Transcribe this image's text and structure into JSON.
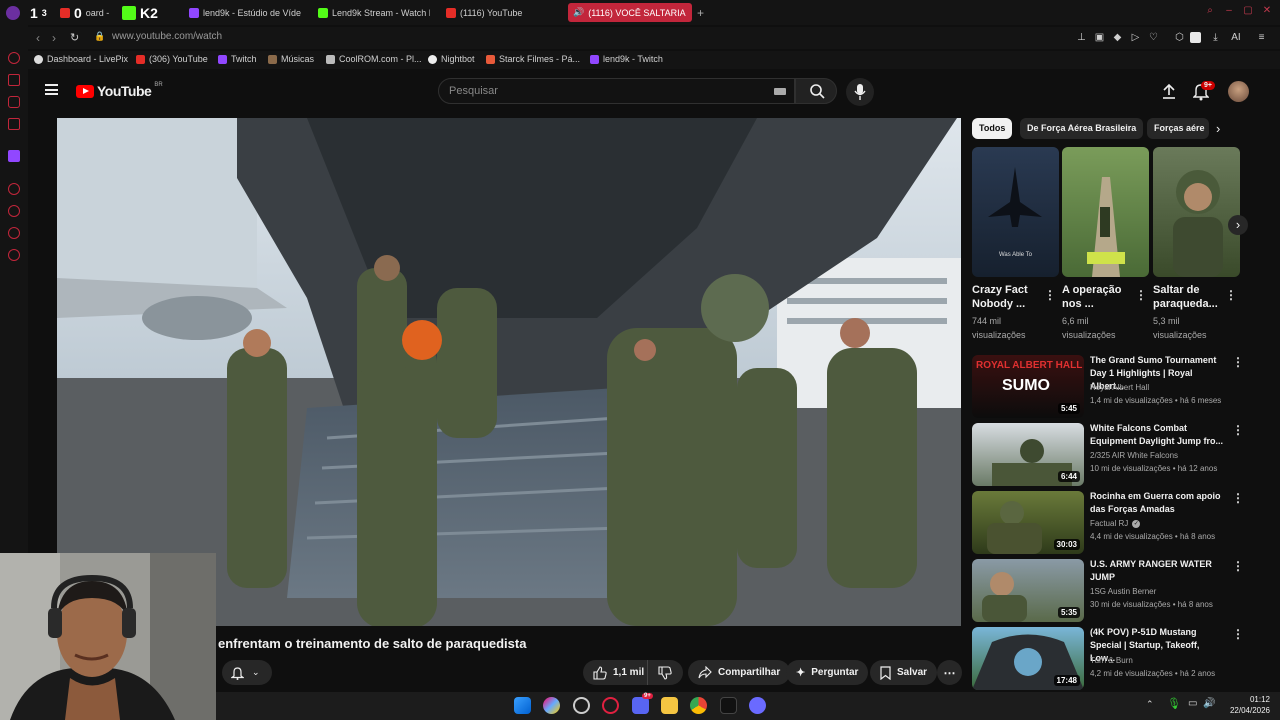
{
  "browser": {
    "tabs": [
      {
        "label": "1",
        "badge": "3"
      },
      {
        "label": "oard -",
        "badge": "0"
      },
      {
        "label": "K2"
      },
      {
        "label": "lend9k - Estúdio de Vídeo"
      },
      {
        "label": "Lend9k Stream - Watch L"
      },
      {
        "label": "(1116) YouTube"
      },
      {
        "label": "(1116) VOCÊ SALTARIA"
      }
    ],
    "url": "www.youtube.com/watch",
    "ai_label": "AI",
    "bookmarks": [
      {
        "label": "Dashboard - LivePix"
      },
      {
        "label": "(306) YouTube"
      },
      {
        "label": "Twitch"
      },
      {
        "label": "Músicas"
      },
      {
        "label": "CoolROM.com - Pl..."
      },
      {
        "label": "Nightbot"
      },
      {
        "label": "Starck Filmes - Pá..."
      },
      {
        "label": "lend9k - Twitch"
      }
    ]
  },
  "youtube": {
    "logo_text": "YouTube",
    "logo_region": "BR",
    "search_placeholder": "Pesquisar",
    "notification_count": "9+",
    "video_title": "enfrentam o treinamento de salto de paraquedista",
    "actions": {
      "like_count": "1,1 mil",
      "share": "Compartilhar",
      "ask": "Perguntar",
      "save": "Salvar"
    },
    "chips": [
      "Todos",
      "De Força Aérea Brasileira",
      "Forças aére"
    ],
    "shorts": [
      {
        "title1": "Crazy Fact",
        "title2": "Nobody ...",
        "views1": "744 mil",
        "views2": "visualizações",
        "overlay": "Was Able To"
      },
      {
        "title1": "A operação",
        "title2": "nos ...",
        "views1": "6,6 mil",
        "views2": "visualizações"
      },
      {
        "title1": "Saltar de",
        "title2": "paraqueda...",
        "views1": "5,3 mil",
        "views2": "visualizações"
      }
    ],
    "videos": [
      {
        "title1": "The Grand Sumo Tournament",
        "title2": "Day 1 Highlights | Royal Albert...",
        "channel": "Royal Albert Hall",
        "meta": "1,4 mi de visualizações • há 6 meses",
        "duration": "5:45",
        "thumb_text1": "ROYAL ALBERT HALL",
        "thumb_text2": "SUMO"
      },
      {
        "title1": "White Falcons Combat",
        "title2": "Equipment Daylight Jump fro...",
        "channel": "2/325 AIR White Falcons",
        "meta": "10 mi de visualizações • há 12 anos",
        "duration": "6:44"
      },
      {
        "title1": "Rocinha em Guerra com apoio",
        "title2": "das Forças Amadas",
        "channel": "Factual RJ",
        "meta": "4,4 mi de visualizações • há 8 anos",
        "duration": "30:03"
      },
      {
        "title1": "U.S. ARMY RANGER WATER",
        "title2": "JUMP",
        "channel": "1SG Austin Berner",
        "meta": "30 mi de visualizações • há 8 anos",
        "duration": "5:35"
      },
      {
        "title1": "(4K POV) P-51D Mustang",
        "title2": "Special | Startup, Takeoff, Low...",
        "channel": "Turn & Burn",
        "meta": "4,2 mi de visualizações • há 2 anos",
        "duration": "17:48"
      }
    ]
  },
  "taskbar": {
    "time": "01:12",
    "date": "22/04/2026",
    "discord_badge": "9+"
  }
}
